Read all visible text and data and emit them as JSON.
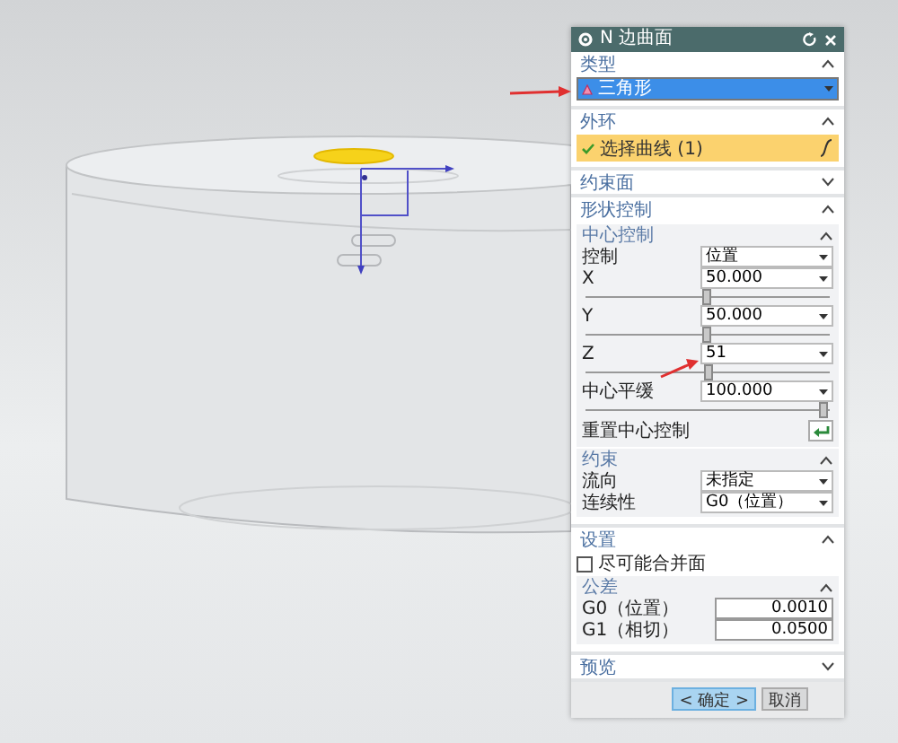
{
  "dialog": {
    "title": "N 边曲面",
    "sections": [
      {
        "title": "类型",
        "expanded": true,
        "items": [
          {
            "kind": "type_select",
            "value": "三角形"
          }
        ]
      },
      {
        "title": "外环",
        "expanded": true,
        "items": [
          {
            "kind": "selection",
            "label": "选择曲线 (1)",
            "done": true
          }
        ]
      },
      {
        "title": "约束面",
        "expanded": false
      },
      {
        "title": "形状控制",
        "expanded": true,
        "items": [
          {
            "kind": "group",
            "title": "中心控制",
            "expanded": true,
            "items": [
              {
                "kind": "field",
                "label": "控制",
                "value": "位置"
              },
              {
                "kind": "field",
                "label": "X",
                "value": "50.000"
              },
              {
                "kind": "slider",
                "level": 0.5
              },
              {
                "kind": "field",
                "label": "Y",
                "value": "50.000"
              },
              {
                "kind": "slider",
                "level": 0.5
              },
              {
                "kind": "field",
                "label": "Z",
                "value": "51"
              },
              {
                "kind": "slider",
                "level": 0.51
              },
              {
                "kind": "field",
                "label": "中心平缓",
                "value": "100.000"
              },
              {
                "kind": "slider",
                "level": 0.98
              },
              {
                "kind": "action",
                "label": "重置中心控制"
              }
            ]
          },
          {
            "kind": "group",
            "title": "约束",
            "expanded": true,
            "items": [
              {
                "kind": "field",
                "label": "流向",
                "value": "未指定"
              },
              {
                "kind": "field",
                "label": "连续性",
                "value": "G0（位置）"
              }
            ]
          }
        ]
      },
      {
        "title": "设置",
        "expanded": true,
        "items": [
          {
            "kind": "checkbox",
            "label": "尽可能合并面",
            "checked": false
          },
          {
            "kind": "group",
            "title": "公差",
            "expanded": true,
            "items": [
              {
                "kind": "number",
                "label": "G0（位置）",
                "value": "0.0010"
              },
              {
                "kind": "number",
                "label": "G1（相切）",
                "value": "0.0500"
              }
            ]
          }
        ]
      },
      {
        "title": "预览",
        "expanded": false
      }
    ]
  },
  "buttons": [
    {
      "label": "< 确定 >",
      "selected": true
    },
    {
      "label": "取消",
      "selected": false
    }
  ]
}
